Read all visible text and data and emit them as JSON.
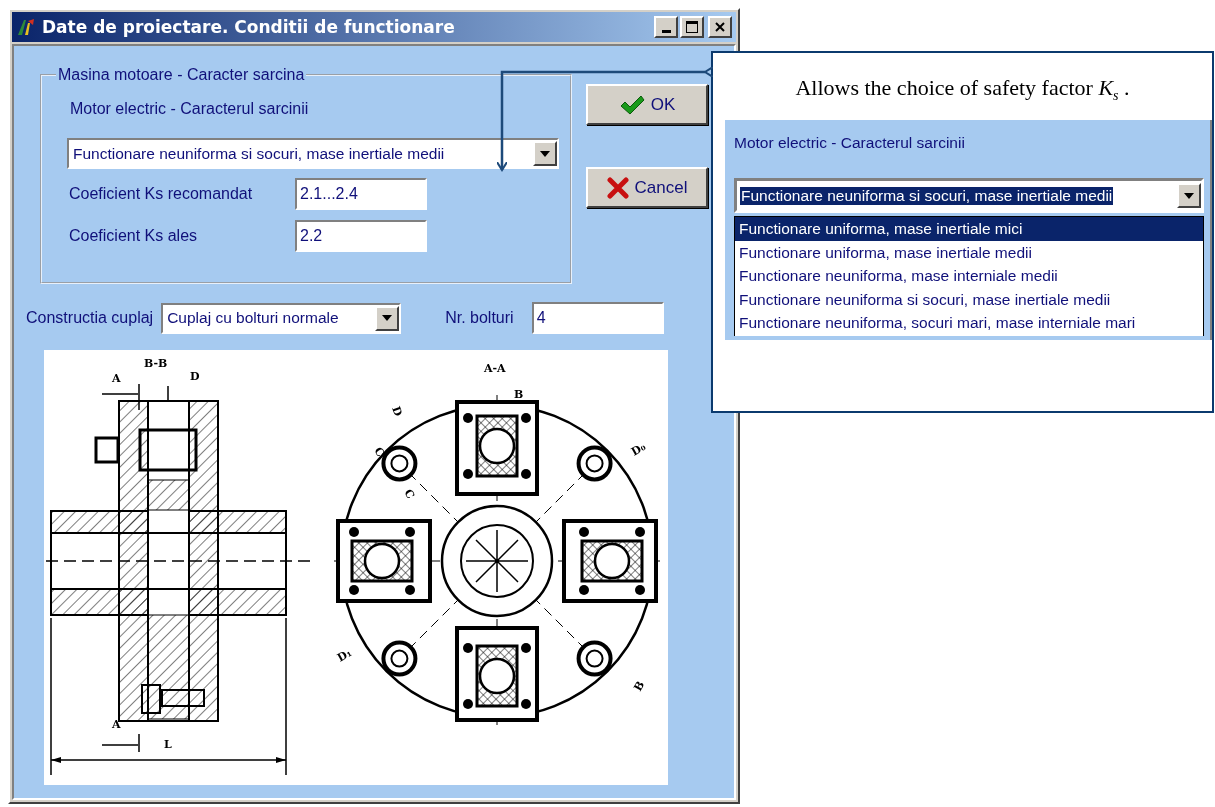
{
  "window": {
    "title": "Date de proiectare. Conditii de functionare"
  },
  "load_group": {
    "legend": "Masina motoare - Caracter sarcina",
    "label": "Motor electric - Caracterul sarcinii",
    "combo": {
      "value": "Functionare neuniforma si socuri, mase inertiale medii"
    },
    "fields": [
      {
        "label": "Coeficient Ks recomandat",
        "value": "2.1...2.4"
      },
      {
        "label": "Coeficient Ks ales",
        "value": "2.2"
      }
    ]
  },
  "buttons": [
    {
      "kind": "ok",
      "label": "OK"
    },
    {
      "kind": "cancel",
      "label": "Cancel"
    }
  ],
  "coupling": {
    "label": "Constructia cuplaj",
    "combo": {
      "value": "Cuplaj cu bolturi normale"
    },
    "bolts_label": "Nr. bolturi",
    "bolts_value": "4"
  },
  "drawing": {
    "labels": [
      "A",
      "B-B",
      "D",
      "A",
      "L",
      "A-A",
      "B",
      "D",
      "C",
      "C",
      "D₀",
      "D₁",
      "B"
    ]
  },
  "callout": {
    "caption": "Allows the choice of safety factor *K*$_{s}$ .",
    "label": "Motor electric - Caracterul sarcinii",
    "combo": {
      "value": "Functionare neuniforma si socuri, mase inertiale medii",
      "focused": true
    },
    "options": [
      {
        "label": "Functionare uniforma, mase inertiale mici",
        "selected": true
      },
      {
        "label": "Functionare uniforma, mase inertiale medii",
        "selected": false
      },
      {
        "label": "Functionare neuniforma, mase interniale medii",
        "selected": false
      },
      {
        "label": "Functionare neuniforma si socuri, mase inertiale medii",
        "selected": false
      },
      {
        "label": "Functionare neuniforma, socuri mari, mase interniale mari",
        "selected": false
      }
    ]
  }
}
